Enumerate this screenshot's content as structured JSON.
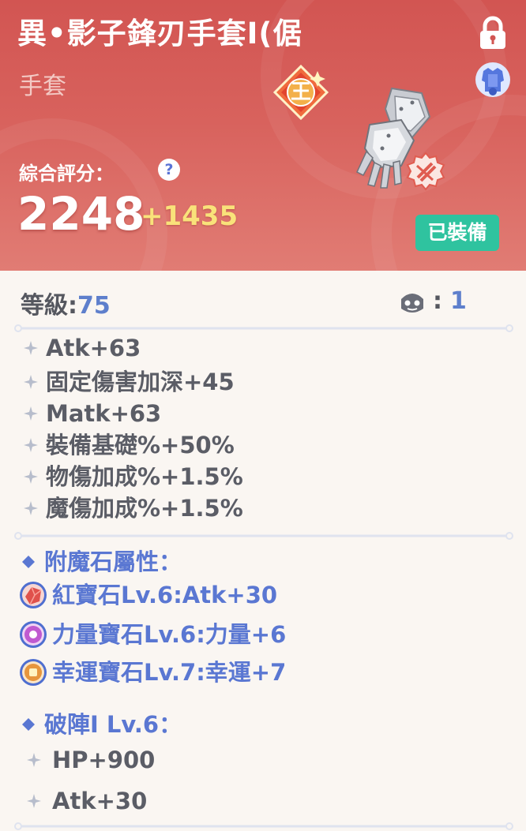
{
  "header": {
    "title": "異•影子鋒刃手套Ⅰ(倨",
    "category": "手套",
    "score_label": "綜合評分：",
    "help_glyph": "?",
    "score": "2248",
    "score_bonus": "+1435",
    "crown_glyph": "王",
    "equipped_label": "已裝備"
  },
  "level": {
    "label": "等級:",
    "value": "75"
  },
  "slots": {
    "colon": ":",
    "count": "1"
  },
  "stats": [
    "Atk+63",
    "固定傷害加深+45",
    "Matk+63",
    "裝備基礎%+50%",
    "物傷加成%+1.5%",
    "魔傷加成%+1.5%"
  ],
  "enchant": {
    "title": "附魔石屬性：",
    "gems": [
      {
        "text": "紅寶石Lv.6:Atk+30",
        "icon": "red-gem-icon",
        "color": "#e0514c"
      },
      {
        "text": "力量寶石Lv.6:力量+6",
        "icon": "strength-gem-icon",
        "color": "#c05ad0"
      },
      {
        "text": "幸運寶石Lv.7:幸運+7",
        "icon": "luck-gem-icon",
        "color": "#e6953c"
      }
    ]
  },
  "breaker": {
    "title": "破陣Ⅰ Lv.6：",
    "stats": [
      "HP+900",
      "Atk+30"
    ]
  },
  "colors": {
    "header_top": "#d25552",
    "accent_blue": "#5a77d2",
    "equipped_green": "#2fc39f",
    "bonus_yellow": "#f9e27a"
  }
}
